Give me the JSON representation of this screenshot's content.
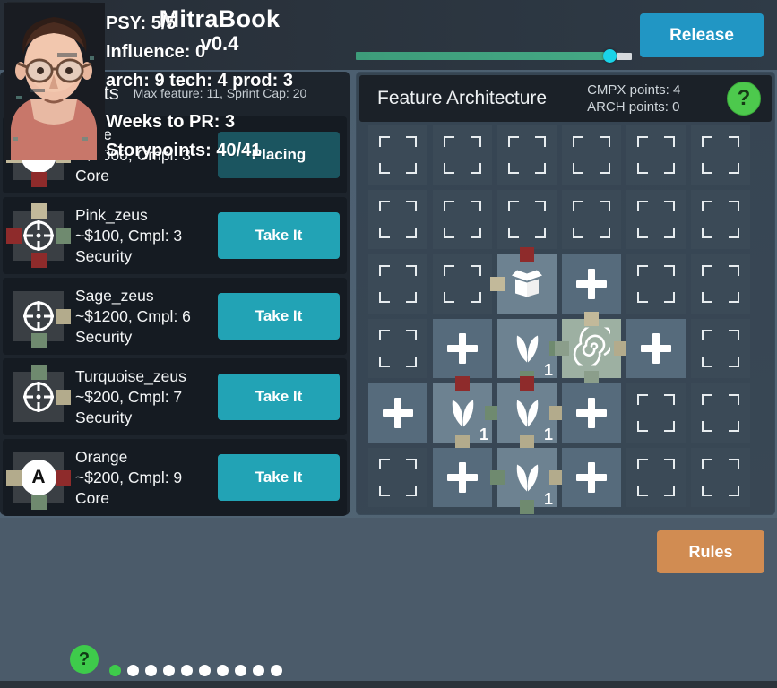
{
  "header": {
    "logo_icon": "illuminati-pyramid-eye-icon",
    "title": "MitraBook",
    "version": "v0.4",
    "release_label": "Release",
    "progress_percent": 97,
    "progress_fill_color": "#44a884",
    "progress_knob_color": "#19d3e8"
  },
  "components_panel": {
    "title": "Components",
    "subtitle": "Max feature: 11, Sprint Cap: 20",
    "items": [
      {
        "name": "Rose",
        "cost_complexity": "~$1000, Cmpl: 3",
        "category": "Core",
        "icon": "letter-a-node-icon",
        "icon_kind": "letter",
        "icon_letter": "A",
        "connectors": {
          "top": "#c2b99a",
          "left": "#c2b99a",
          "right": "#c2b99a",
          "bottom": "#8e2b2b"
        },
        "button_label": "Placing",
        "button_state": "placing"
      },
      {
        "name": "Pink_zeus",
        "cost_complexity": "~$100, Cmpl: 3",
        "category": "Security",
        "icon": "crosshair-node-icon",
        "icon_kind": "cross",
        "icon_letter": "",
        "connectors": {
          "top": "#c2b99a",
          "left": "#8e2b2b",
          "right": "#6f8a6f",
          "bottom": "#8e2b2b"
        },
        "button_label": "Take It",
        "button_state": "take"
      },
      {
        "name": "Sage_zeus",
        "cost_complexity": "~$1200, Cmpl: 6",
        "category": "Security",
        "icon": "crosshair-node-icon",
        "icon_kind": "cross",
        "icon_letter": "",
        "connectors": {
          "top": null,
          "left": null,
          "right": "#b3ab8c",
          "bottom": "#6f8a6f"
        },
        "button_label": "Take It",
        "button_state": "take"
      },
      {
        "name": "Turquoise_zeus",
        "cost_complexity": "~$200, Cmpl: 7",
        "category": "Security",
        "icon": "crosshair-node-icon",
        "icon_kind": "cross",
        "icon_letter": "",
        "connectors": {
          "top": "#6f8a6f",
          "left": null,
          "right": "#b3ab8c",
          "bottom": null
        },
        "button_label": "Take It",
        "button_state": "take"
      },
      {
        "name": "Orange",
        "cost_complexity": "~$200, Cmpl: 9",
        "category": "Core",
        "icon": "letter-a-node-icon",
        "icon_kind": "letter",
        "icon_letter": "A",
        "connectors": {
          "top": null,
          "left": "#b3ab8c",
          "right": "#8e2b2b",
          "bottom": "#6f8a6f"
        },
        "button_label": "Take It",
        "button_state": "take"
      }
    ]
  },
  "architecture_panel": {
    "title": "Feature Architecture",
    "cmpx_points_label": "CMPX points: 4",
    "arch_points_label": "ARCH points: 0",
    "help_label": "?",
    "grid": {
      "rows": 6,
      "cols": 6,
      "cells": [
        [
          {
            "state": "empty"
          },
          {
            "state": "empty"
          },
          {
            "state": "empty"
          },
          {
            "state": "empty"
          },
          {
            "state": "empty"
          },
          {
            "state": "empty"
          }
        ],
        [
          {
            "state": "empty"
          },
          {
            "state": "empty"
          },
          {
            "state": "empty"
          },
          {
            "state": "empty"
          },
          {
            "state": "empty"
          },
          {
            "state": "empty"
          }
        ],
        [
          {
            "state": "empty"
          },
          {
            "state": "empty"
          },
          {
            "state": "filled",
            "icon": "open-box-icon",
            "badge": "",
            "connectors": {
              "top": "#8e2b2b",
              "left": "#c2b99a",
              "right": null,
              "bottom": null
            }
          },
          {
            "state": "plus"
          },
          {
            "state": "empty"
          },
          {
            "state": "empty"
          }
        ],
        [
          {
            "state": "empty"
          },
          {
            "state": "plus"
          },
          {
            "state": "filled",
            "icon": "leaf-icon",
            "badge": "1",
            "connectors": {
              "top": null,
              "left": null,
              "right": "#6f8a6f",
              "bottom": "#6f8a6f"
            }
          },
          {
            "state": "highlight",
            "icon": "spiral-icon",
            "badge": "",
            "connectors": {
              "top": "#c2b99a",
              "left": "#8b9e8b",
              "right": "#b3ab8c",
              "bottom": "#8b9e8b"
            }
          },
          {
            "state": "plus"
          },
          {
            "state": "empty"
          }
        ],
        [
          {
            "state": "plus"
          },
          {
            "state": "filled",
            "icon": "leaf-icon",
            "badge": "1",
            "connectors": {
              "top": "#8e2b2b",
              "left": null,
              "right": "#6f8a6f",
              "bottom": "#b3ab8c"
            }
          },
          {
            "state": "filled",
            "icon": "leaf-icon",
            "badge": "1",
            "connectors": {
              "top": "#8e2b2b",
              "left": null,
              "right": "#b3ab8c",
              "bottom": "#b3ab8c"
            }
          },
          {
            "state": "plus"
          },
          {
            "state": "empty"
          },
          {
            "state": "empty"
          }
        ],
        [
          {
            "state": "empty"
          },
          {
            "state": "plus"
          },
          {
            "state": "filled",
            "icon": "leaf-icon",
            "badge": "1",
            "connectors": {
              "top": null,
              "left": "#6f8a6f",
              "right": "#b3ab8c",
              "bottom": "#6f8a6f"
            }
          },
          {
            "state": "plus"
          },
          {
            "state": "empty"
          },
          {
            "state": "empty"
          }
        ]
      ]
    }
  },
  "status_bar": {
    "avatar_icon": "player-portrait-avatar",
    "avatar_help_label": "?",
    "psy": "PSY: 5/5",
    "influence": "Influence: 0",
    "skills": "arch: 9 tech: 4 prod: 3",
    "weeks_to_pr": "Weeks to PR: 3",
    "storypoints": "Storypoints: 40/41",
    "week_dots": {
      "total": 10,
      "active_index": 0
    },
    "rules_label": "Rules"
  },
  "colors": {
    "background": "#4e6172",
    "panel_dark": "#1d242c",
    "accent_teal": "#22a3b5",
    "accent_blue": "#2196c4",
    "accent_orange": "#d18c52",
    "accent_green": "#3ecb4b"
  }
}
